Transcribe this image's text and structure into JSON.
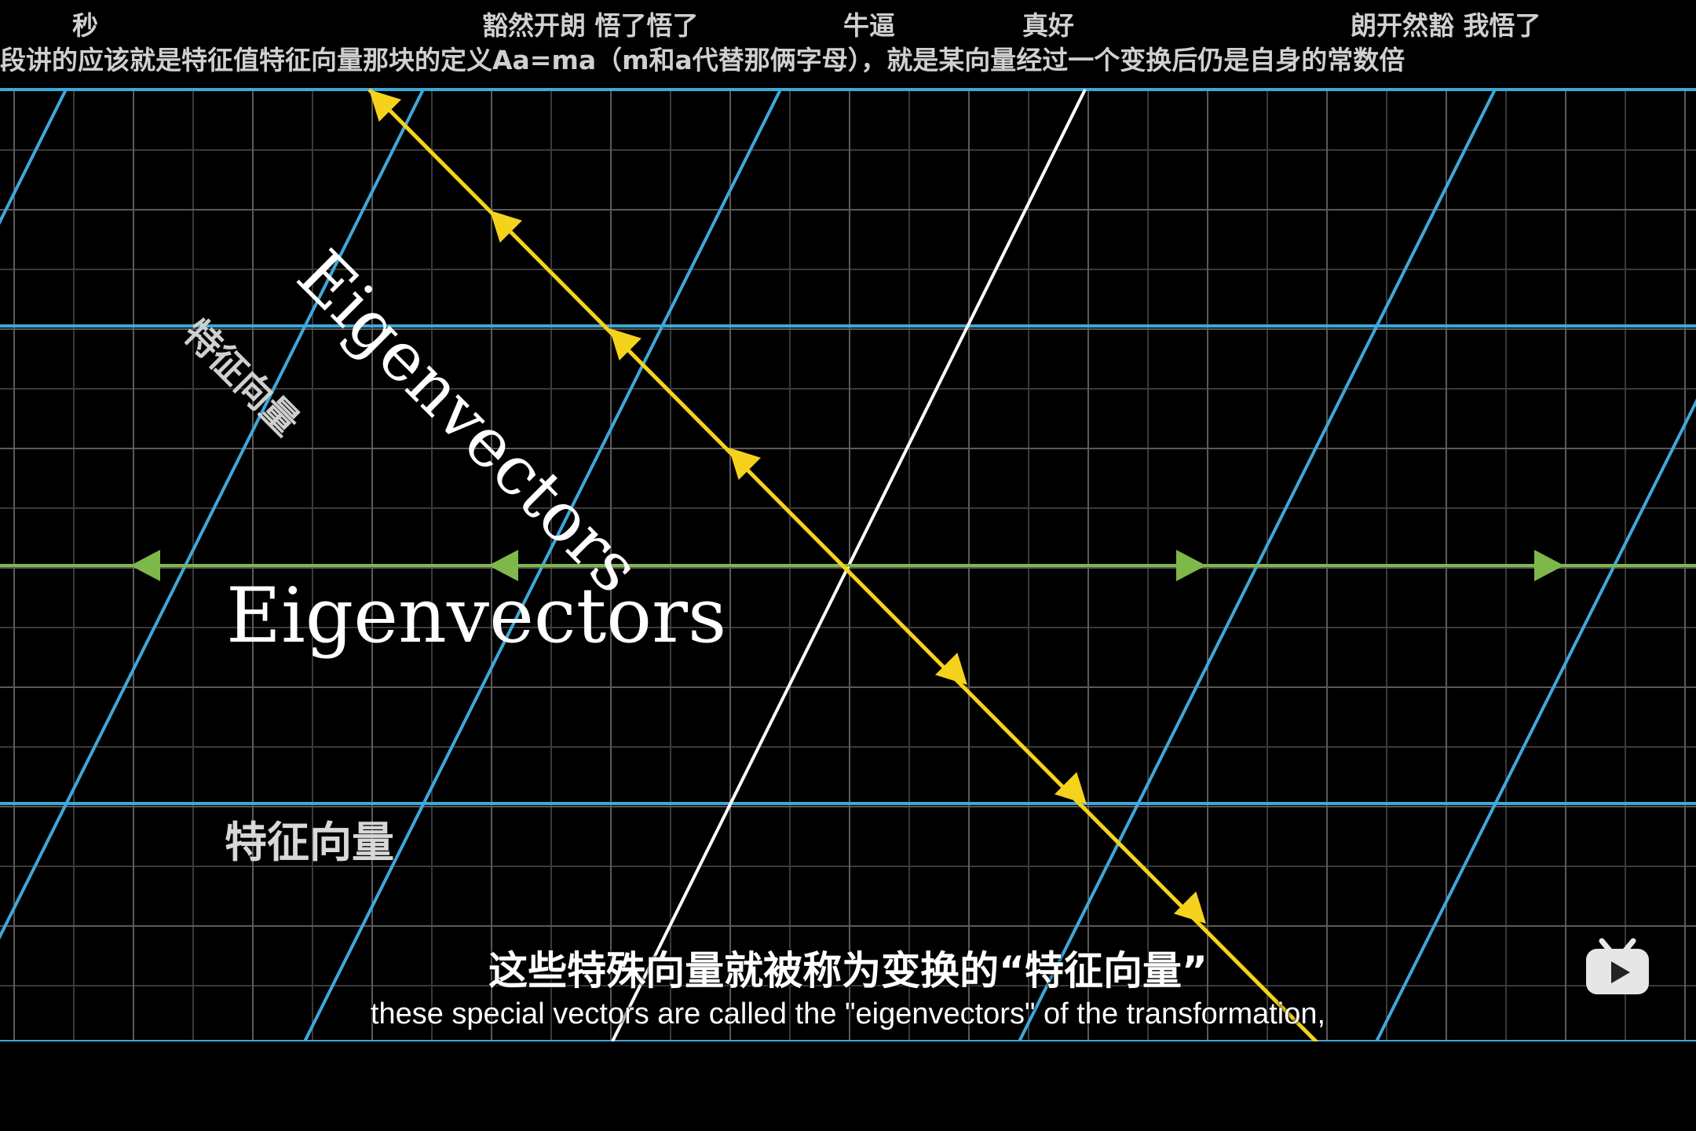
{
  "danmaku": {
    "row1": [
      {
        "text": "秒"
      },
      {
        "text": "豁然开朗 悟了悟了"
      },
      {
        "text": "牛逼"
      },
      {
        "text": "真好"
      },
      {
        "text": "朗开然豁  我悟了"
      }
    ],
    "row2": [
      {
        "text": "段讲的应该就是特征值特征向量那块的定义Aa=ma（m和a代替那俩字母），就是某向量经过一个变换后仍是自身的常数倍"
      }
    ]
  },
  "video": {
    "labels": {
      "diag_en": "Eigenvectors",
      "diag_cn": "特征向量",
      "horiz_en": "Eigenvectors",
      "horiz_cn": "特征向量"
    },
    "colors": {
      "grid": "#3a3a3a",
      "transformed_grid": "#3ea8d8",
      "eigen_diagonal": "#f5d21c",
      "eigen_horizontal": "#7fb84a",
      "basis_line": "#ffffff"
    }
  },
  "subtitle": {
    "cn": "这些特殊向量就被称为变换的“特征向量”",
    "en": "these special vectors are called the \"eigenvectors\" of the transformation,"
  },
  "player": {
    "logo_icon": "bilibili-tv-icon"
  }
}
